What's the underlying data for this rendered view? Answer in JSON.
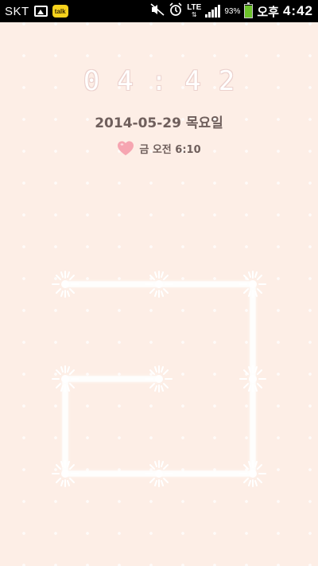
{
  "status_bar": {
    "carrier": "SKT",
    "icons": [
      "gallery-icon",
      "kakaotalk-icon",
      "silent-mode-icon",
      "alarm-icon",
      "lte-icon",
      "signal-icon",
      "battery-icon"
    ],
    "talk_badge": "talk",
    "network": "LTE",
    "battery_percent": "93%",
    "battery_level": 0.93,
    "ampm": "오후",
    "time": "4:42"
  },
  "lock_screen": {
    "clock": "04:42",
    "date": "2014-05-29 목요일",
    "next_alarm": "금 오전 6:10",
    "colors": {
      "background": "#fdeee6",
      "text": "#6f5f5c",
      "heart": "#f6a5b1"
    }
  },
  "pattern": {
    "dots": 9,
    "drawn_path": [
      "top-left",
      "top-middle",
      "top-right",
      "middle-right",
      "bottom-right",
      "bottom-middle",
      "bottom-left",
      "middle-left",
      "middle-middle"
    ]
  }
}
